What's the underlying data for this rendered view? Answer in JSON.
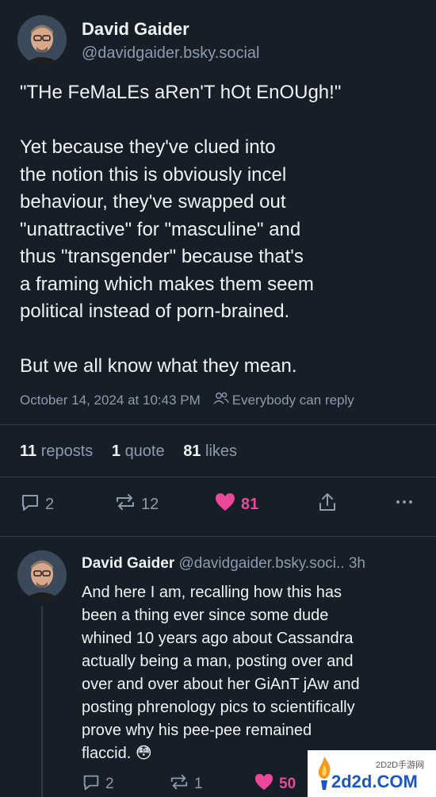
{
  "post": {
    "author_name": "David Gaider",
    "author_handle": "@davidgaider.bsky.social",
    "text_lines": [
      "\"THe FeMaLEs aRen'T hOt EnOUgh!\"",
      "",
      "Yet because they've clued into",
      "the notion this is obviously incel",
      "behaviour, they've swapped out",
      "\"unattractive\" for \"masculine\" and",
      "thus \"transgender\" because that's",
      "a framing which makes them seem",
      "political instead of porn-brained.",
      "",
      "But we all know what they mean."
    ],
    "timestamp": "October 14, 2024 at 10:43 PM",
    "reply_permission": "Everybody can reply",
    "stats": {
      "reposts_count": "11",
      "reposts_label": "reposts",
      "quotes_count": "1",
      "quotes_label": "quote",
      "likes_count": "81",
      "likes_label": "likes"
    },
    "actions": {
      "reply_count": "2",
      "repost_count": "12",
      "like_count": "81"
    },
    "colors": {
      "background": "#161e27",
      "text": "#f1f3f5",
      "muted": "#8d9bab",
      "like": "#ec4899"
    }
  },
  "reply": {
    "author_name": "David Gaider",
    "author_handle": "@davidgaider.bsky.soci..",
    "time": "3h",
    "text_lines": [
      "And here I am, recalling how this has",
      "been a thing ever since some dude",
      "whined 10 years ago about Cassandra",
      "actually being a man, posting over and",
      "over and over about her GiAnT jAw and",
      "posting phrenology pics to scientifically",
      "prove why his pee-pee remained",
      "flaccid."
    ],
    "emoji": "😳",
    "actions": {
      "reply_count": "2",
      "repost_count": "1",
      "like_count": "50"
    }
  },
  "watermark": {
    "small_text": "2D2D手游网",
    "site_text": "2d2d.COM"
  }
}
